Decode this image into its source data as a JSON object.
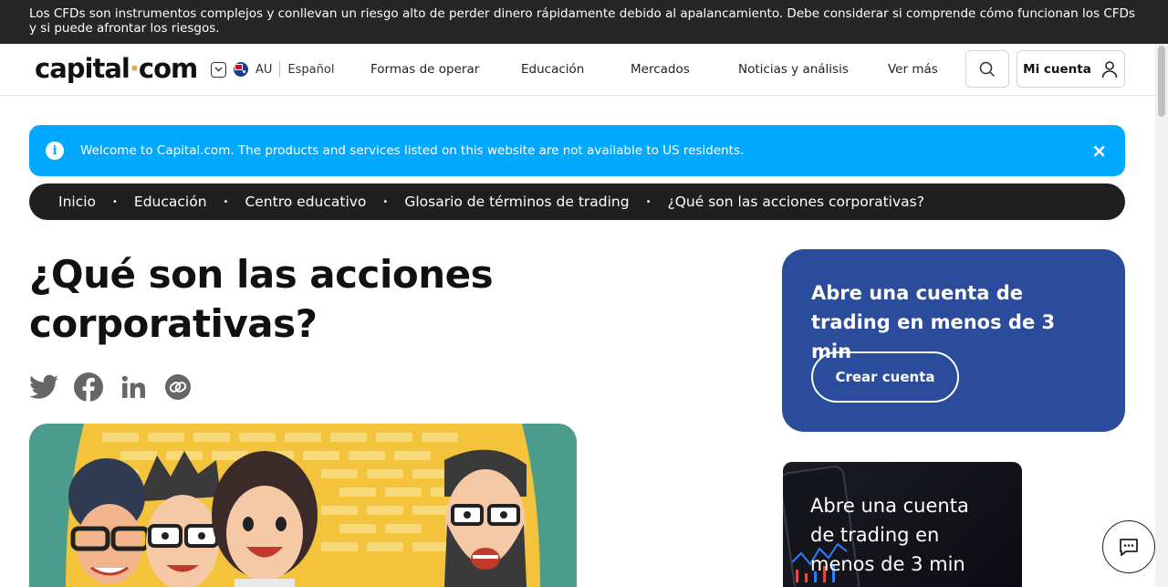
{
  "risk_warning": "Los CFDs son instrumentos complejos y conllevan un riesgo alto de perder dinero rápidamente debido al apalancamiento. Debe considerar si comprende cómo funcionan los CFDs y si puede afrontar los riesgos.",
  "header": {
    "logo_left": "capital",
    "logo_dot": "·",
    "logo_right": "com",
    "region": "AU",
    "language": "Español",
    "nav": [
      "Formas de operar",
      "Educación",
      "Mercados",
      "Noticias y análisis",
      "Ver más"
    ],
    "account_label": "Mi cuenta"
  },
  "notice": {
    "text": "Welcome to Capital.com. The products and services listed on this website are not available to US residents.",
    "close": "×"
  },
  "breadcrumb": [
    "Inicio",
    "Educación",
    "Centro educativo",
    "Glosario de términos de trading",
    "¿Qué son las acciones corporativas?"
  ],
  "breadcrumb_sep": "•",
  "article": {
    "title": "¿Qué son las acciones corporativas?"
  },
  "cta": {
    "title": "Abre una cuenta de trading en menos de 3 min",
    "button": "Crear cuenta"
  },
  "promo": {
    "text": "Abre una cuenta de trading en menos de 3 min"
  },
  "colors": {
    "risk_bar": "#262626",
    "notice": "#00a8ff",
    "cta_card": "#2b4b9b",
    "logo_dot": "#e7a54b"
  }
}
